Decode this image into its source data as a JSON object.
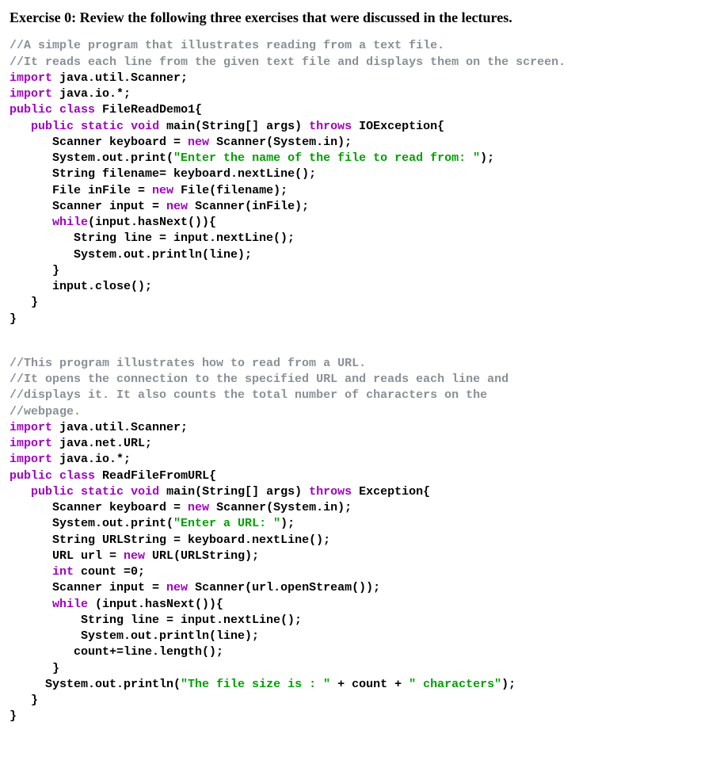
{
  "heading": "Exercise 0: Review the following three exercises that were discussed in the lectures.",
  "block1": {
    "c1": "//A simple program that illustrates reading from a text file.",
    "c2": "//It reads each line from the given text file and displays them on the screen.",
    "kw_import1": "import",
    "imp1": " java.util.Scanner;",
    "kw_import2": "import",
    "imp2": " java.io.*;",
    "kw_public": "public",
    "kw_class": "class",
    "classname": " FileReadDemo1{",
    "indent1": "   ",
    "kw_ps": "public",
    "kw_static": "static",
    "kw_void": "void",
    "main_sig": " main(String[] args) ",
    "kw_throws": "throws",
    "throws_rest": " IOException{",
    "indent2": "      ",
    "l_scanner1": "Scanner keyboard = ",
    "kw_new1": "new",
    "l_scanner1b": " Scanner(System.in);",
    "l_print1a": "System.out.print(",
    "str1": "\"Enter the name of the file to read from: \"",
    "l_print1b": ");",
    "l_filename": "String filename= keyboard.nextLine();",
    "l_file1a": "File inFile = ",
    "kw_new2": "new",
    "l_file1b": " File(filename);",
    "l_input1a": "Scanner input = ",
    "kw_new3": "new",
    "l_input1b": " Scanner(inFile);",
    "kw_while": "while",
    "l_while": "(input.hasNext()){",
    "indent3": "         ",
    "l_line": "String line = input.nextLine();",
    "l_println": "System.out.println(line);",
    "l_brace": "}",
    "l_close": "input.close();",
    "l_brace2": "}"
  },
  "block2": {
    "c1": "//This program illustrates how to read from a URL.",
    "c2": "//It opens the connection to the specified URL and reads each line and",
    "c3": "//displays it. It also counts the total number of characters on the",
    "c4": "//webpage.",
    "kw_import1": "import",
    "imp1": " java.util.Scanner;",
    "kw_import2": "import",
    "imp2": " java.net.URL;",
    "kw_import3": "import",
    "imp3": " java.io.*;",
    "kw_public": "public",
    "kw_class": "class",
    "classname": " ReadFileFromURL{",
    "indent1": "   ",
    "kw_ps": "public",
    "kw_static": "static",
    "kw_void": "void",
    "main_sig": " main(String[] args) ",
    "kw_throws": "throws",
    "throws_rest": " Exception{",
    "indent2": "      ",
    "l_scanner1": "Scanner keyboard = ",
    "kw_new1": "new",
    "l_scanner1b": " Scanner(System.in);",
    "l_print1a": "System.out.print(",
    "str1": "\"Enter a URL: \"",
    "l_print1b": ");",
    "l_urlstring": "String URLString = keyboard.nextLine();",
    "l_url1a": "URL url = ",
    "kw_new2": "new",
    "l_url1b": " URL(URLString);",
    "kw_int": "int",
    "l_count": " count =0;",
    "l_input1a": "Scanner input = ",
    "kw_new3": "new",
    "l_input1b": " Scanner(url.openStream());",
    "kw_while": "while",
    "l_while": " (input.hasNext()){",
    "indent3a": "          ",
    "l_line": "String line = input.nextLine();",
    "l_println": "System.out.println(line);",
    "indent3b": "         ",
    "l_countplus": "count+=line.length();",
    "l_brace": "}",
    "indent1b": "     ",
    "l_final1": "System.out.println(",
    "str2": "\"The file size is : \"",
    "l_final2": " + count + ",
    "str3": "\" characters\"",
    "l_final3": ");",
    "l_brace2": "}"
  }
}
